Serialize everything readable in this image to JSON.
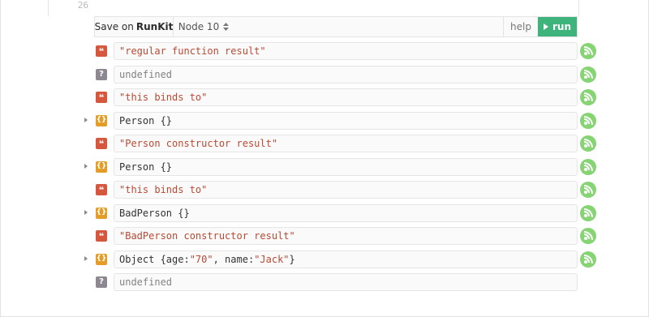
{
  "code": {
    "line_number": "26"
  },
  "toolbar": {
    "save_text": "Save on",
    "save_brand": "RunKit",
    "node_version": "Node 10",
    "help_label": "help",
    "run_label": "run"
  },
  "outputs": [
    {
      "kind": "string",
      "icon": "❝",
      "value": "\"regular function result\""
    },
    {
      "kind": "undefined",
      "icon": "?",
      "value": "undefined"
    },
    {
      "kind": "string",
      "icon": "❝",
      "value": "\"this binds to\""
    },
    {
      "kind": "object",
      "icon": "{}",
      "value": "Person {}"
    },
    {
      "kind": "string",
      "icon": "❝",
      "value": "\"Person constructor result\""
    },
    {
      "kind": "object",
      "icon": "{}",
      "value": "Person {}"
    },
    {
      "kind": "string",
      "icon": "❝",
      "value": "\"this binds to\""
    },
    {
      "kind": "object",
      "icon": "{}",
      "value": "BadPerson {}"
    },
    {
      "kind": "string",
      "icon": "❝",
      "value": "\"BadPerson constructor result\""
    },
    {
      "kind": "object",
      "icon": "{}",
      "value": "Object {age: \"70\", name: \"Jack\"}",
      "parts": [
        "Object {age: ",
        "\"70\"",
        ", name: ",
        "\"Jack\"",
        "}"
      ]
    },
    {
      "kind": "undefined",
      "icon": "?",
      "value": "undefined"
    }
  ],
  "colors": {
    "run": "#3fb37c",
    "string_badge": "#d4573e",
    "object_badge": "#e39d28",
    "undefined_badge": "#8c8791",
    "feed": "#86d474"
  },
  "icons": {
    "string": "quote-icon",
    "object": "object-braces-icon",
    "undefined": "question-mark-icon",
    "feed": "rss-feed-icon",
    "expand": "expand-triangle-icon",
    "run": "play-icon",
    "version": "sort-caret-icon"
  }
}
